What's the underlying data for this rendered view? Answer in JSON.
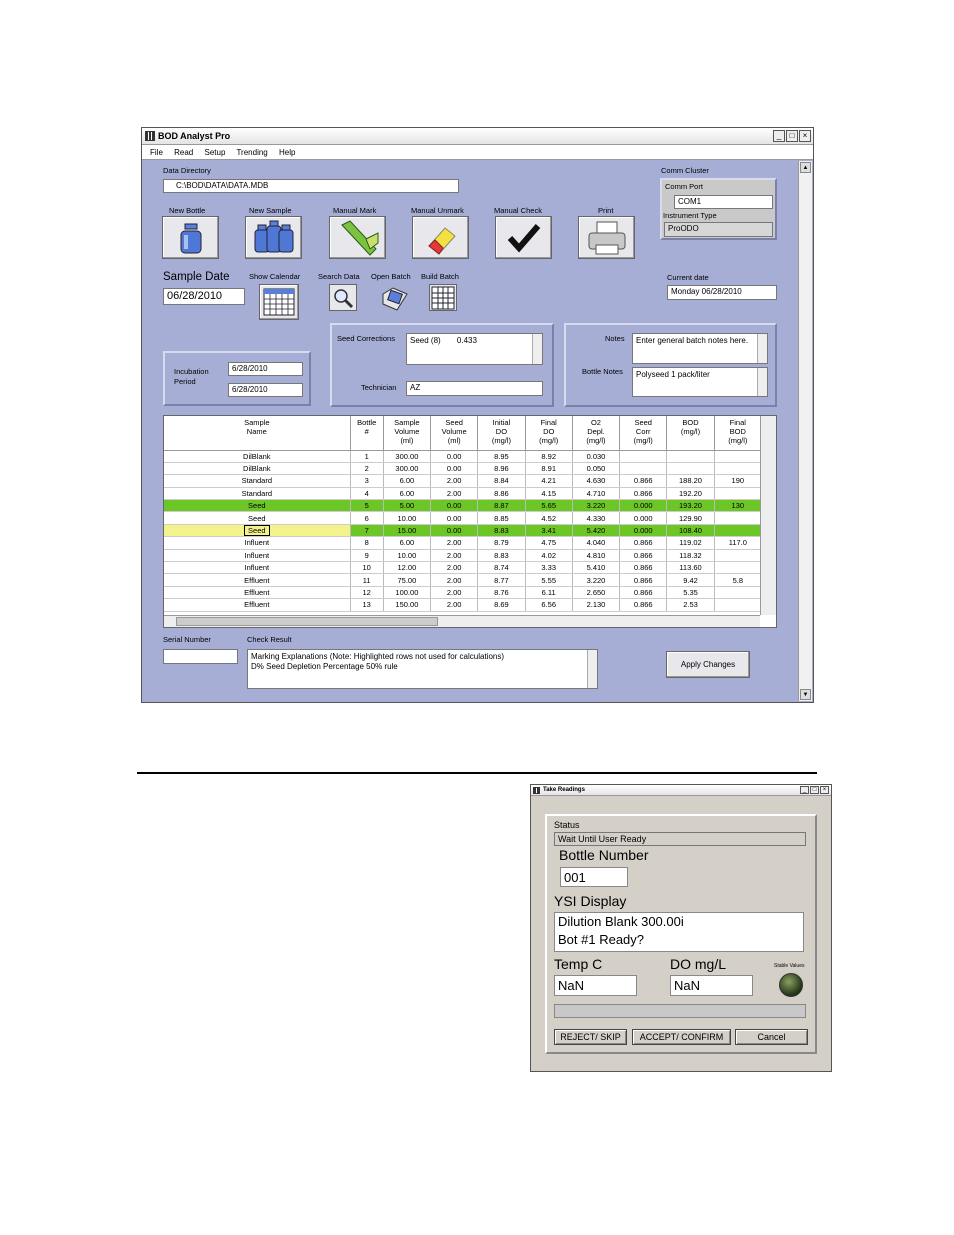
{
  "main_window": {
    "title": "BOD Analyst Pro",
    "menu": [
      "File",
      "Read",
      "Setup",
      "Trending",
      "Help"
    ],
    "data_directory": {
      "label": "Data Directory",
      "value": "C:\\BOD\\DATA\\DATA.MDB"
    },
    "comm": {
      "cluster_label": "Comm Cluster",
      "port_label": "Comm Port",
      "port_value": "COM1",
      "instrument_label": "Instrument Type",
      "instrument_value": "ProODO"
    },
    "toolbar": {
      "new_bottle": "New Bottle",
      "new_sample": "New Sample",
      "manual_mark": "Manual Mark",
      "manual_unmark": "Manual Unmark",
      "manual_check": "Manual Check",
      "print": "Print"
    },
    "sample_date": {
      "label": "Sample Date",
      "value": "06/28/2010"
    },
    "show_calendar": "Show Calendar",
    "search_data": "Search Data",
    "open_batch": "Open Batch",
    "build_batch": "Build Batch",
    "current_date": {
      "label": "Current date",
      "value": "Monday 06/28/2010"
    },
    "incubation": {
      "label_line1": "Incubation",
      "label_line2": "Period",
      "start": "6/28/2010",
      "end": "6/28/2010"
    },
    "seed_corrections": {
      "label": "Seed Corrections",
      "value_name": "Seed (8)",
      "value_num": "0.433"
    },
    "technician": {
      "label": "Technician",
      "value": "AZ"
    },
    "notes": {
      "label": "Notes",
      "value": "Enter general batch notes here."
    },
    "bottle_notes": {
      "label": "Bottle Notes",
      "value": "Polyseed 1 pack/liter"
    },
    "grid": {
      "headers": [
        [
          "Sample",
          "Name"
        ],
        [
          "Bottle",
          "#"
        ],
        [
          "Sample",
          "Volume",
          "(ml)"
        ],
        [
          "Seed",
          "Volume",
          "(ml)"
        ],
        [
          "Initial",
          "DO",
          "(mg/l)"
        ],
        [
          "Final",
          "DO",
          "(mg/l)"
        ],
        [
          "O2",
          "Depl.",
          "(mg/l)"
        ],
        [
          "Seed",
          "Corr",
          "(mg/l)"
        ],
        [
          "BOD",
          "(mg/l)"
        ],
        [
          "Final",
          "BOD",
          "(mg/l)"
        ]
      ],
      "rows": [
        {
          "style": "",
          "cells": [
            "DilBlank",
            "1",
            "300.00",
            "0.00",
            "8.95",
            "8.92",
            "0.030",
            "",
            "",
            ""
          ]
        },
        {
          "style": "",
          "cells": [
            "DilBlank",
            "2",
            "300.00",
            "0.00",
            "8.96",
            "8.91",
            "0.050",
            "",
            "",
            ""
          ]
        },
        {
          "style": "",
          "cells": [
            "Standard",
            "3",
            "6.00",
            "2.00",
            "8.84",
            "4.21",
            "4.630",
            "0.866",
            "188.20",
            "190"
          ]
        },
        {
          "style": "",
          "cells": [
            "Standard",
            "4",
            "6.00",
            "2.00",
            "8.86",
            "4.15",
            "4.710",
            "0.866",
            "192.20",
            ""
          ]
        },
        {
          "style": "green",
          "cells": [
            "Seed",
            "5",
            "5.00",
            "0.00",
            "8.87",
            "5.65",
            "3.220",
            "0.000",
            "193.20",
            "130"
          ]
        },
        {
          "style": "",
          "cells": [
            "Seed",
            "6",
            "10.00",
            "0.00",
            "8.85",
            "4.52",
            "4.330",
            "0.000",
            "129.90",
            ""
          ]
        },
        {
          "style": "green yellow",
          "cells": [
            "Seed",
            "7",
            "15.00",
            "0.00",
            "8.83",
            "3.41",
            "5.420",
            "0.000",
            "108.40",
            ""
          ]
        },
        {
          "style": "",
          "cells": [
            "Influent",
            "8",
            "6.00",
            "2.00",
            "8.79",
            "4.75",
            "4.040",
            "0.866",
            "119.02",
            "117.0"
          ]
        },
        {
          "style": "",
          "cells": [
            "Influent",
            "9",
            "10.00",
            "2.00",
            "8.83",
            "4.02",
            "4.810",
            "0.866",
            "118.32",
            ""
          ]
        },
        {
          "style": "",
          "cells": [
            "Influent",
            "10",
            "12.00",
            "2.00",
            "8.74",
            "3.33",
            "5.410",
            "0.866",
            "113.60",
            ""
          ]
        },
        {
          "style": "",
          "cells": [
            "Effluent",
            "11",
            "75.00",
            "2.00",
            "8.77",
            "5.55",
            "3.220",
            "0.866",
            "9.42",
            "5.8"
          ]
        },
        {
          "style": "",
          "cells": [
            "Effluent",
            "12",
            "100.00",
            "2.00",
            "8.76",
            "6.11",
            "2.650",
            "0.866",
            "5.35",
            ""
          ]
        },
        {
          "style": "",
          "cells": [
            "Effluent",
            "13",
            "150.00",
            "2.00",
            "8.69",
            "6.56",
            "2.130",
            "0.866",
            "2.53",
            ""
          ]
        }
      ]
    },
    "serial_number": {
      "label": "Serial Number",
      "value": ""
    },
    "check_result": {
      "label": "Check Result",
      "line1": "Marking Explanations (Note: Highlighted rows not used for calculations)",
      "line2": "D% Seed Depletion Percentage 50% rule"
    },
    "apply_changes": "Apply Changes"
  },
  "take_readings": {
    "title": "Take Readings",
    "status_label": "Status",
    "status_value": "Wait Until User Ready",
    "bottle_number_label": "Bottle Number",
    "bottle_number_value": "001",
    "ysi_label": "YSI Display",
    "ysi_line1": "Dilution Blank 300.00i",
    "ysi_line2": "Bot #1 Ready?",
    "temp_label": "Temp C",
    "temp_value": "NaN",
    "do_label": "DO mg/L",
    "do_value": "NaN",
    "stable_label": "Stable Values",
    "reject_button": "REJECT/ SKIP",
    "accept_button": "ACCEPT/ CONFIRM",
    "cancel_button": "Cancel"
  }
}
